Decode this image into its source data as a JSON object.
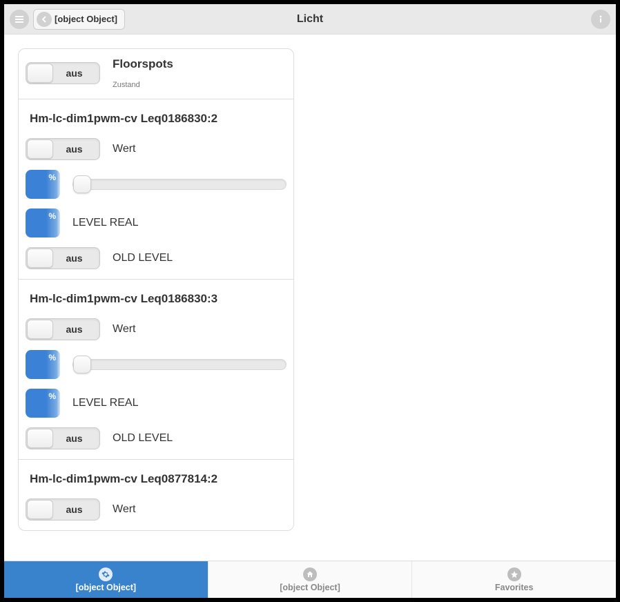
{
  "header": {
    "title": "Licht",
    "back_label": "[object Object]"
  },
  "top_device": {
    "toggle_label": "aus",
    "title": "Floorspots",
    "subtitle": "Zustand"
  },
  "channels": [
    {
      "heading": "Hm-lc-dim1pwm-cv Leq0186830:2",
      "wert_toggle": "aus",
      "wert_label": "Wert",
      "pct_symbol": "%",
      "level_real_pct_symbol": "%",
      "level_real_label": "LEVEL REAL",
      "old_level_toggle": "aus",
      "old_level_label": "OLD LEVEL"
    },
    {
      "heading": "Hm-lc-dim1pwm-cv Leq0186830:3",
      "wert_toggle": "aus",
      "wert_label": "Wert",
      "pct_symbol": "%",
      "level_real_pct_symbol": "%",
      "level_real_label": "LEVEL REAL",
      "old_level_toggle": "aus",
      "old_level_label": "OLD LEVEL"
    },
    {
      "heading": "Hm-lc-dim1pwm-cv Leq0877814:2",
      "wert_toggle": "aus",
      "wert_label": "Wert"
    }
  ],
  "footer": {
    "tab1": "[object Object]",
    "tab2": "[object Object]",
    "tab3": "Favorites"
  }
}
